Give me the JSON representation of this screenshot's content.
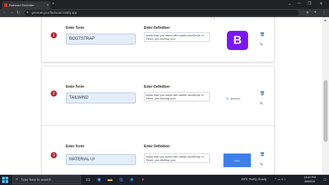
{
  "browser": {
    "tab_title": "Flashcard Generator",
    "tab_close": "×",
    "new_tab": "+",
    "url": "generateyourflashcard.netlify.app",
    "window_controls": {
      "minimize": "—",
      "restore": "❐",
      "close": "✕",
      "tabs": "⌄"
    },
    "nav": {
      "back": "←",
      "forward": "→",
      "reload": "↻"
    }
  },
  "form": {
    "term_label": "Enter Term",
    "definition_label": "Enter Definition",
    "required_mark": "*",
    "definition_preview": "inside than you would with vanilla JavaScript. In React, you develop your",
    "cards": [
      {
        "number": "1",
        "term": "BOOTSTRAP",
        "image_text": "B"
      },
      {
        "number": "2",
        "term": "TAILWIND",
        "image_text": "tailwindcss"
      },
      {
        "number": "3",
        "term": "MATERIAL UI",
        "image_text": "MUI"
      }
    ]
  },
  "actions": {
    "delete_icon": "🗑",
    "edit_icon": "✎"
  },
  "taskbar": {
    "search_placeholder": "Type here to search",
    "weather": "29°C  Partly cloudy",
    "time": "10:41 PM",
    "date": "5/8/2022"
  },
  "colors": {
    "badge": "#b3202a",
    "term_bg": "#e5eef8",
    "bootstrap_purple": "#7b16f5",
    "mui_blue": "#3f7fe8",
    "action_icon": "#2c4a8a"
  }
}
